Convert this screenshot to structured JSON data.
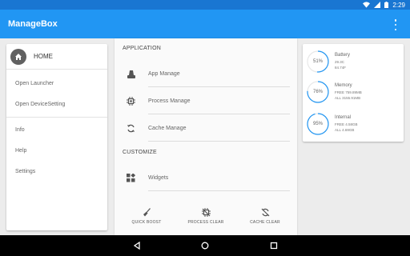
{
  "status_bar": {
    "time": "2:29"
  },
  "app_bar": {
    "title": "ManageBox"
  },
  "left_menu": {
    "home_label": "HOME",
    "group1": [
      "Open Launcher",
      "Open DeviceSetting"
    ],
    "group2": [
      "Info",
      "Help",
      "Settings"
    ]
  },
  "middle": {
    "application_header": "APPLICATION",
    "application_items": [
      {
        "label": "App Manage",
        "icon": "app-manage-icon"
      },
      {
        "label": "Process Manage",
        "icon": "process-chip-icon"
      },
      {
        "label": "Cache Manage",
        "icon": "refresh-icon"
      }
    ],
    "customize_header": "CUSTOMIZE",
    "customize_items": [
      {
        "label": "Widgets",
        "icon": "widgets-icon"
      }
    ],
    "actions": [
      {
        "label": "QUICK BOOST",
        "icon": "broom-icon"
      },
      {
        "label": "PROCESS CLEAR",
        "icon": "process-clear-icon"
      },
      {
        "label": "CACHE CLEAR",
        "icon": "cache-clear-icon"
      }
    ]
  },
  "stats": [
    {
      "name": "Battery",
      "percent_text": "51%",
      "percent": 51,
      "line1": "29.3C",
      "line2": "84.74F"
    },
    {
      "name": "Memory",
      "percent_text": "76%",
      "percent": 76,
      "line1": "FREE 759.89MB",
      "line2": "ALL 3155.91MB"
    },
    {
      "name": "Internal",
      "percent_text": "95%",
      "percent": 95,
      "line1": "FREE 4.58GB",
      "line2": "ALL 4.69GB"
    }
  ],
  "colors": {
    "primary": "#2196f3",
    "primary_dark": "#1976d2",
    "ring": "#2196f3"
  }
}
